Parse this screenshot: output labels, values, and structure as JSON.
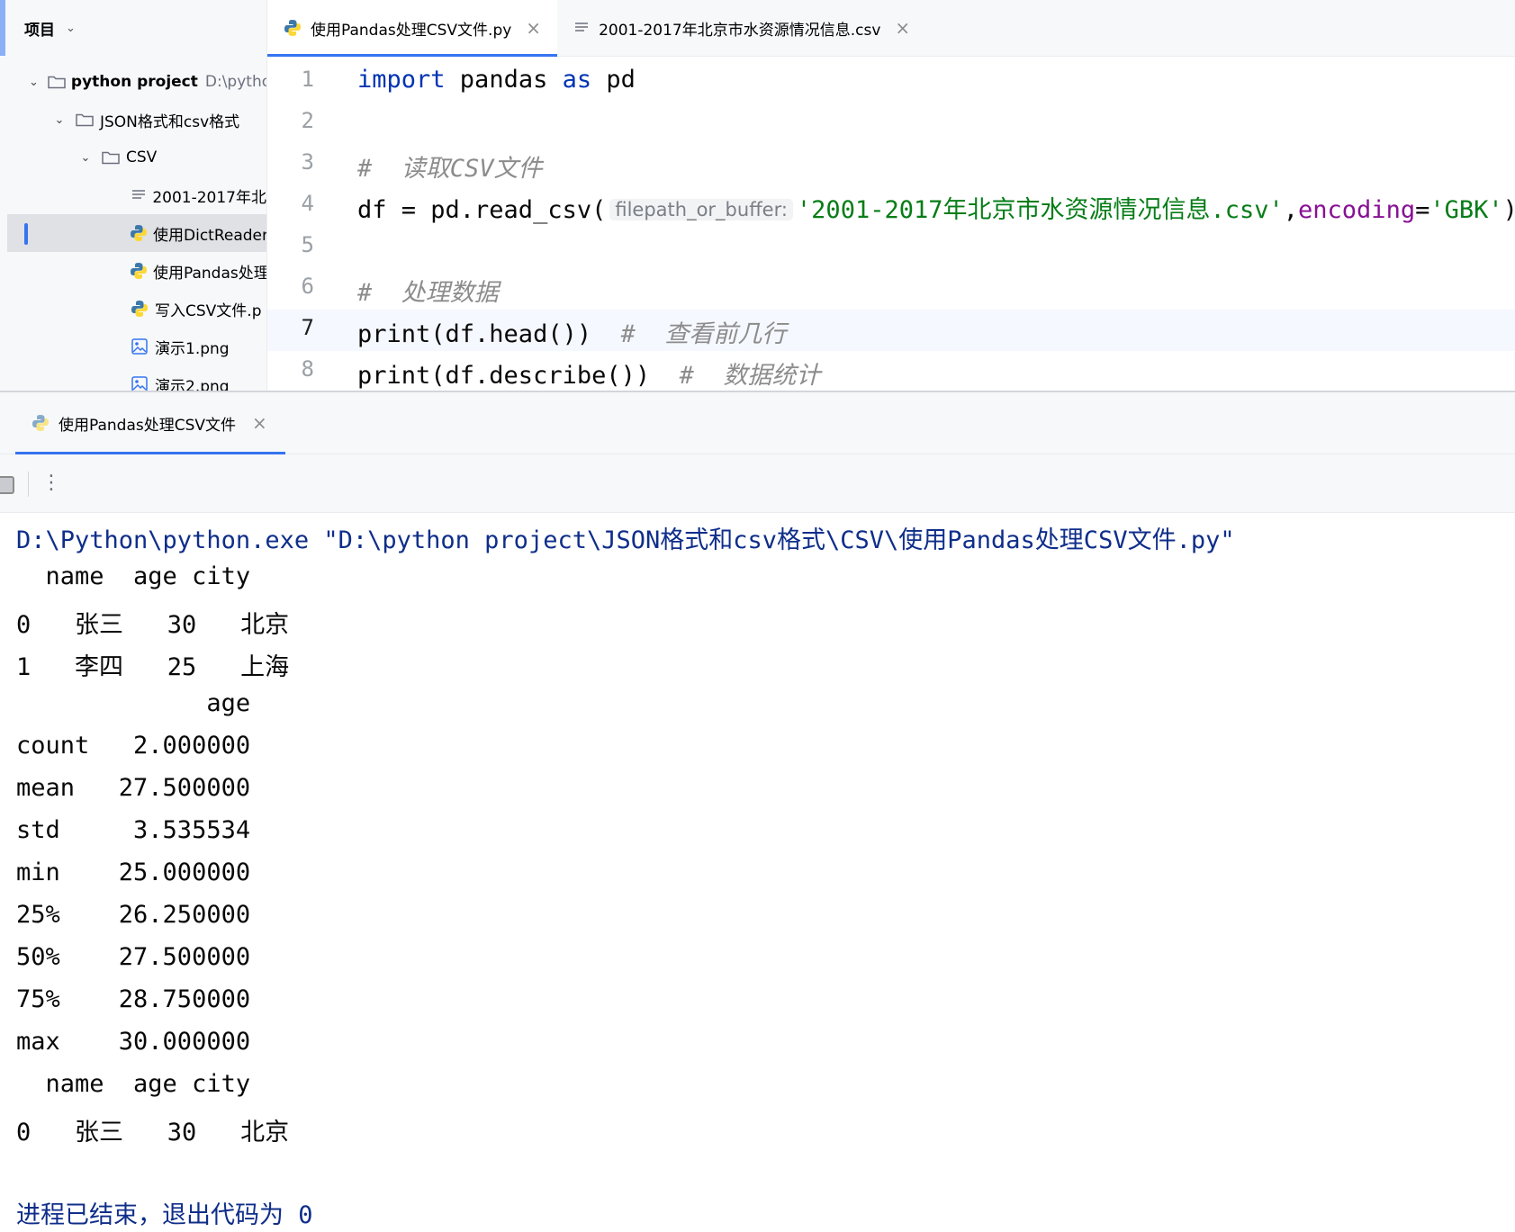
{
  "project_panel": {
    "title": "项目",
    "tree": [
      {
        "label": "python project",
        "hint": "D:\\python"
      },
      {
        "label": "JSON格式和csv格式"
      },
      {
        "label": "CSV"
      },
      {
        "label": "2001-2017年北"
      },
      {
        "label": "使用DictReader"
      },
      {
        "label": "使用Pandas处理"
      },
      {
        "label": "写入CSV文件.p"
      },
      {
        "label": "演示1.png"
      },
      {
        "label": "演示2.png"
      }
    ]
  },
  "editor": {
    "tabs": [
      {
        "label": "使用Pandas处理CSV文件.py",
        "active": true
      },
      {
        "label": "2001-2017年北京市水资源情况信息.csv",
        "active": false
      }
    ],
    "current_line": 7,
    "code": {
      "l1": {
        "kw1": "import",
        "mod": " pandas ",
        "kw2": "as",
        "alias": " pd"
      },
      "l3": "#  读取CSV文件",
      "l4": {
        "pre": "df = pd.read_csv(",
        "hint": "filepath_or_buffer:",
        "str": "'2001-2017年北京市水资源情况信息.csv'",
        "comma": ",",
        "param": "encoding",
        "eq": "=",
        "str2": "'GBK'",
        "close": ")"
      },
      "l6": "#  处理数据",
      "l7": {
        "code": "print(df.head())",
        "comment": "#  查看前几行"
      },
      "l8": {
        "code": "print(df.describe())",
        "comment": "#  数据统计"
      }
    },
    "line_numbers": [
      "1",
      "2",
      "3",
      "4",
      "5",
      "6",
      "7",
      "8"
    ]
  },
  "run_panel": {
    "tab_label": "使用Pandas处理CSV文件",
    "command": "D:\\Python\\python.exe \"D:\\python project\\JSON格式和csv格式\\CSV\\使用Pandas处理CSV文件.py\"",
    "output": [
      "  name  age city",
      "0   张三   30   北京",
      "1   李四   25   上海",
      "             age",
      "count   2.000000",
      "mean   27.500000",
      "std     3.535534",
      "min    25.000000",
      "25%    26.250000",
      "50%    27.500000",
      "75%    28.750000",
      "max    30.000000",
      "  name  age city",
      "0   张三   30   北京"
    ],
    "exit_message": "进程已结束，退出代码为 0"
  },
  "colors": {
    "accent": "#3574f0",
    "keyword": "#0033b3",
    "string": "#067d17",
    "comment": "#8c8c8c",
    "console_command": "#0f2e8a"
  },
  "icons": [
    "chevron-down-icon",
    "folder-icon",
    "text-file-icon",
    "python-file-icon",
    "image-file-icon",
    "close-icon",
    "stop-icon",
    "more-options-icon"
  ]
}
